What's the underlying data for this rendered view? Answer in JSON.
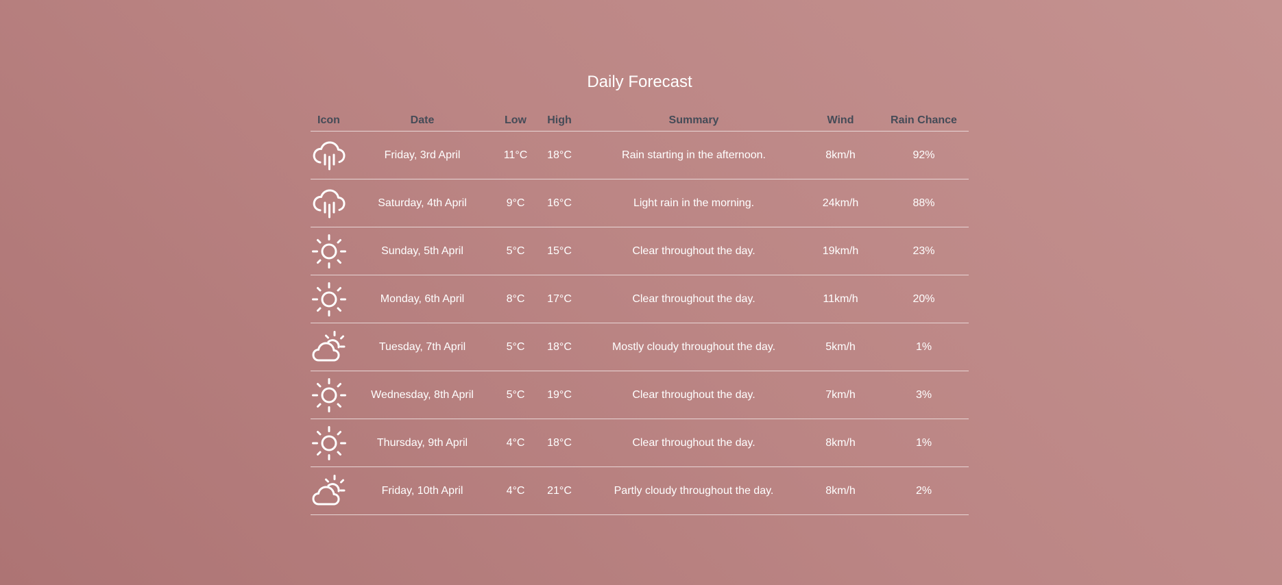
{
  "page": {
    "title": "Daily Forecast"
  },
  "table": {
    "headers": {
      "icon": "Icon",
      "date": "Date",
      "low": "Low",
      "high": "High",
      "summary": "Summary",
      "wind": "Wind",
      "rain": "Rain Chance"
    },
    "rows": [
      {
        "icon": "rain-icon",
        "date": "Friday, 3rd April",
        "low": "11°C",
        "high": "18°C",
        "summary": "Rain starting in the afternoon.",
        "wind": "8km/h",
        "rain": "92%"
      },
      {
        "icon": "rain-icon",
        "date": "Saturday, 4th April",
        "low": "9°C",
        "high": "16°C",
        "summary": "Light rain in the morning.",
        "wind": "24km/h",
        "rain": "88%"
      },
      {
        "icon": "sun-icon",
        "date": "Sunday, 5th April",
        "low": "5°C",
        "high": "15°C",
        "summary": "Clear throughout the day.",
        "wind": "19km/h",
        "rain": "23%"
      },
      {
        "icon": "sun-icon",
        "date": "Monday, 6th April",
        "low": "8°C",
        "high": "17°C",
        "summary": "Clear throughout the day.",
        "wind": "11km/h",
        "rain": "20%"
      },
      {
        "icon": "partly-cloudy-icon",
        "date": "Tuesday, 7th April",
        "low": "5°C",
        "high": "18°C",
        "summary": "Mostly cloudy throughout the day.",
        "wind": "5km/h",
        "rain": "1%"
      },
      {
        "icon": "sun-icon",
        "date": "Wednesday, 8th April",
        "low": "5°C",
        "high": "19°C",
        "summary": "Clear throughout the day.",
        "wind": "7km/h",
        "rain": "3%"
      },
      {
        "icon": "sun-icon",
        "date": "Thursday, 9th April",
        "low": "4°C",
        "high": "18°C",
        "summary": "Clear throughout the day.",
        "wind": "8km/h",
        "rain": "1%"
      },
      {
        "icon": "partly-cloudy-icon",
        "date": "Friday, 10th April",
        "low": "4°C",
        "high": "21°C",
        "summary": "Partly cloudy throughout the day.",
        "wind": "8km/h",
        "rain": "2%"
      }
    ]
  },
  "colors": {
    "background_start": "#ad7474",
    "background_end": "#c49290",
    "header_text": "#454b57",
    "body_text": "#ffffff",
    "divider": "#e8d6d6"
  }
}
